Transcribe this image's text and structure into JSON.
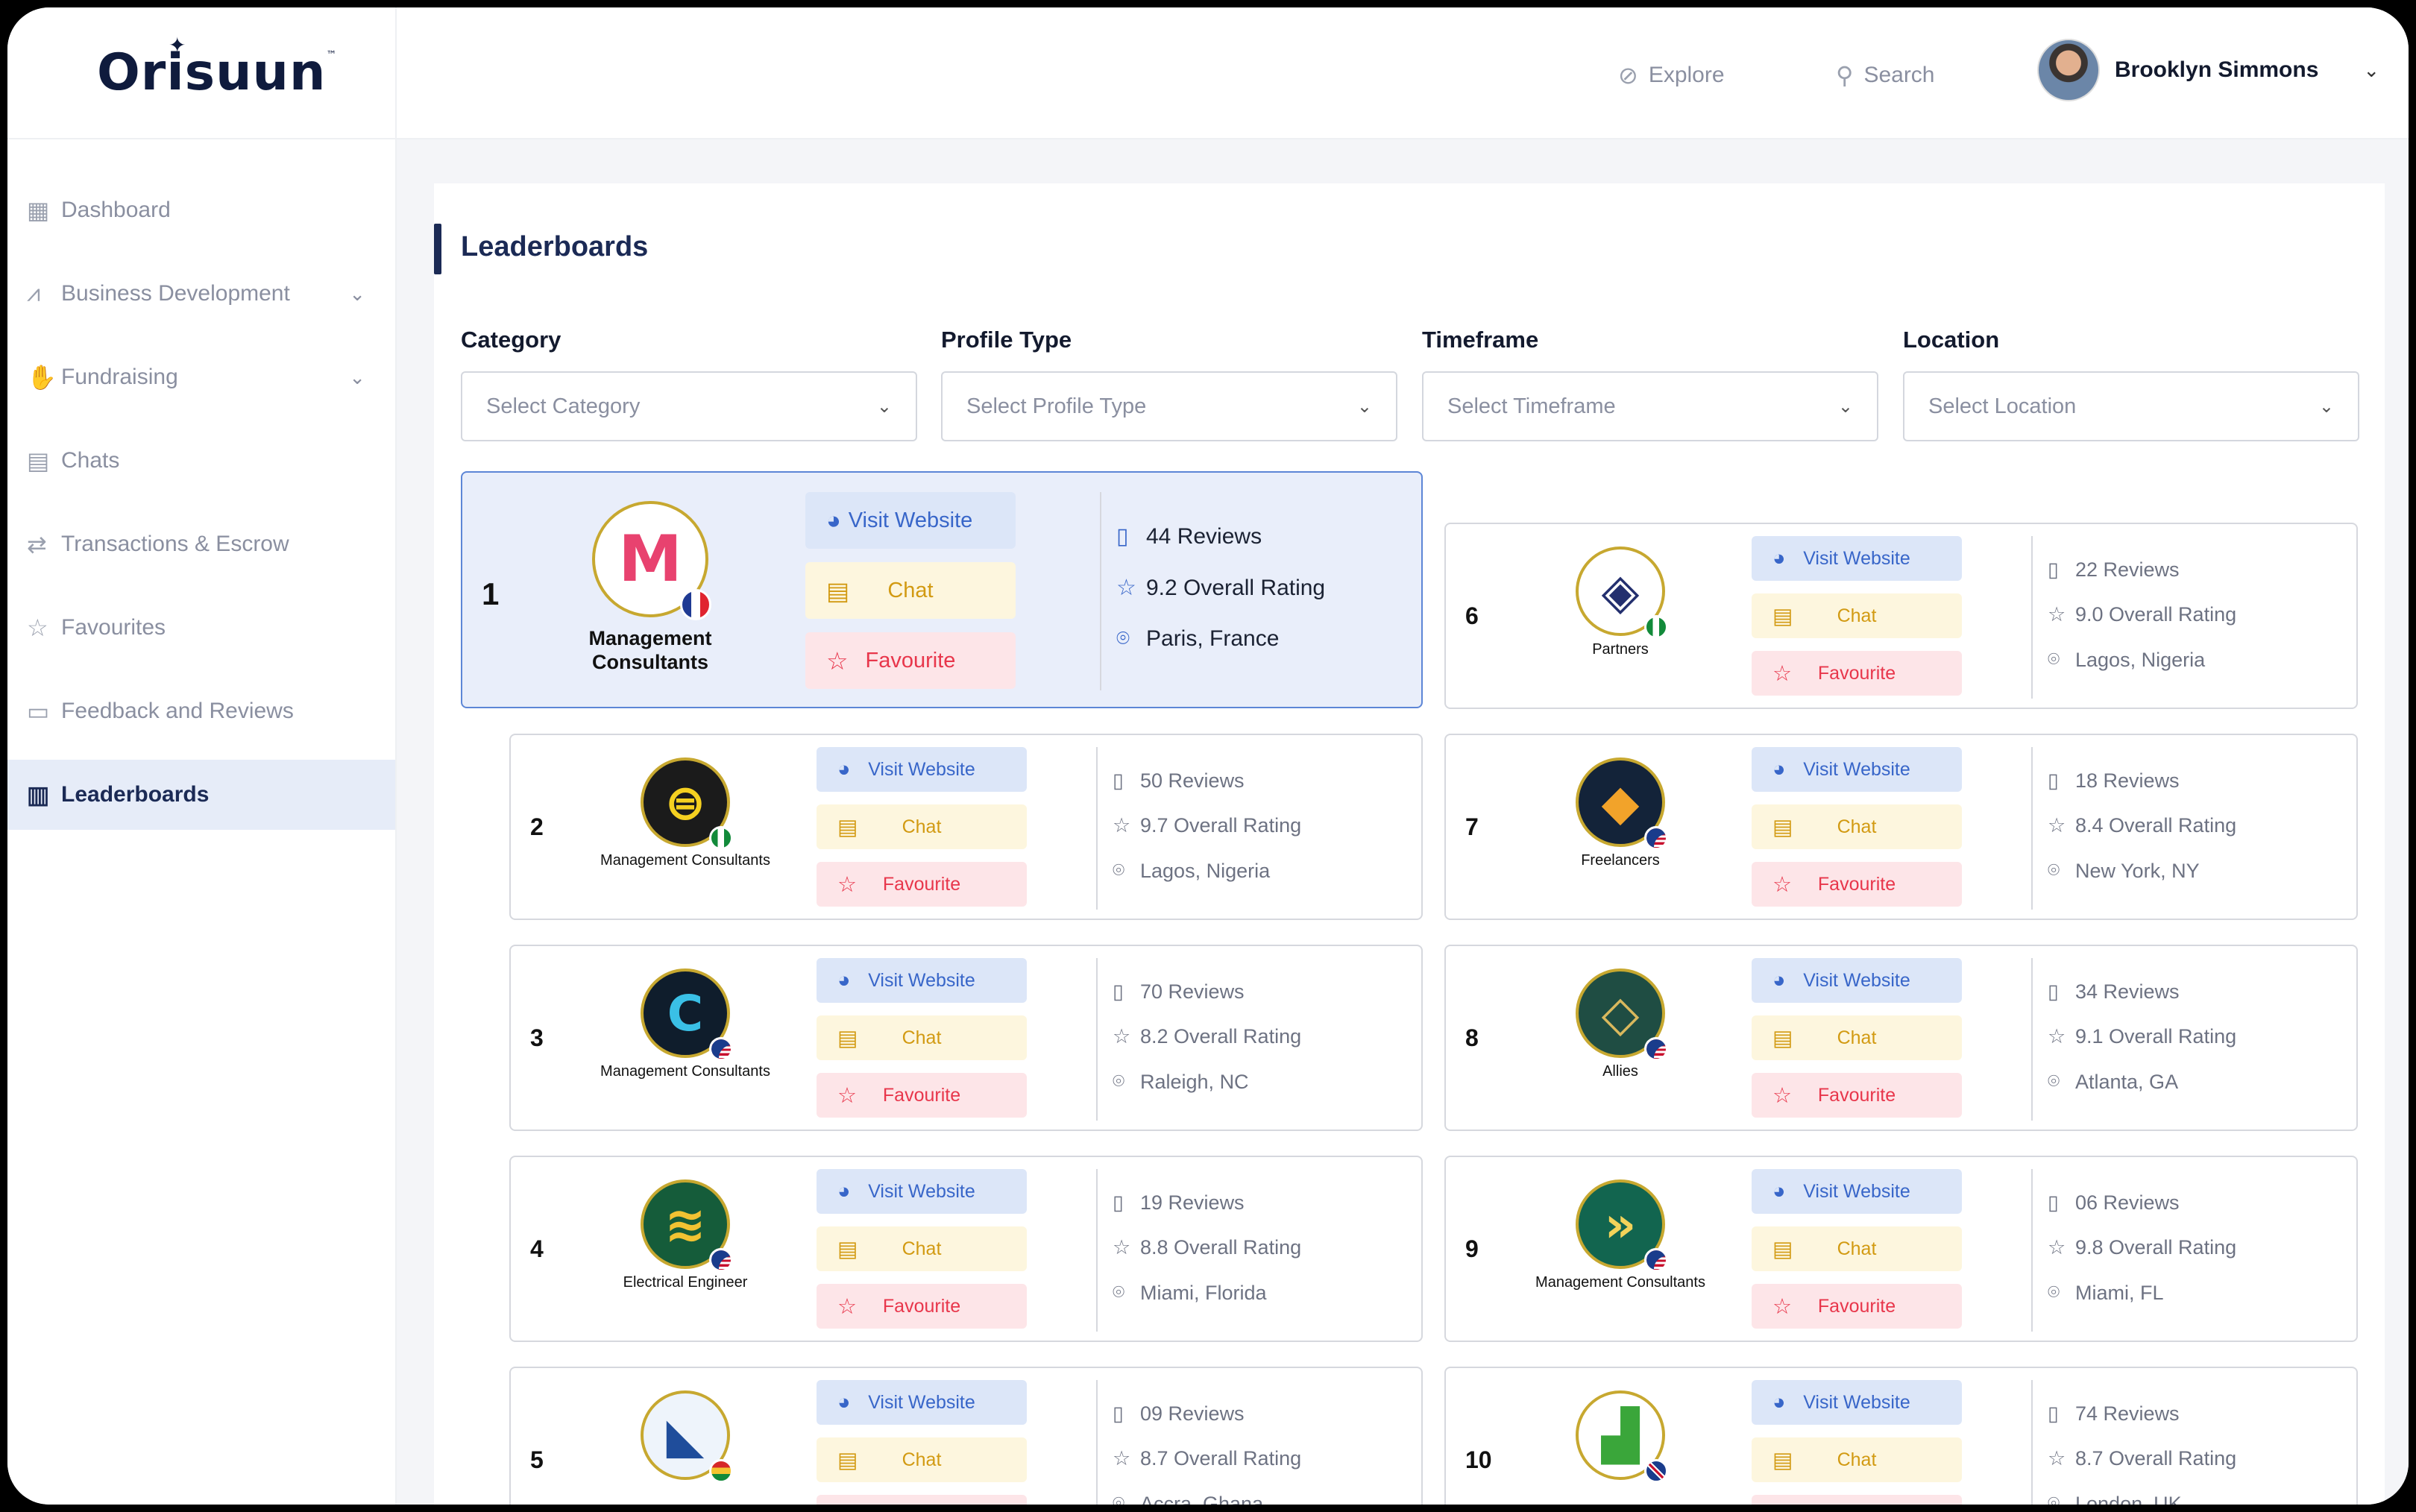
{
  "brand": {
    "name": "Orisuun",
    "tm": "™"
  },
  "sidebar": {
    "items": [
      {
        "label": "Dashboard",
        "icon": "grid-icon",
        "glyph": "▦",
        "chevron": false,
        "active": false
      },
      {
        "label": "Business Development",
        "icon": "chart-up-icon",
        "glyph": "⩘",
        "chevron": true,
        "active": false
      },
      {
        "label": "Fundraising",
        "icon": "handshake-icon",
        "glyph": "✋",
        "chevron": true,
        "active": false
      },
      {
        "label": "Chats",
        "icon": "message-icon",
        "glyph": "▤",
        "chevron": false,
        "active": false
      },
      {
        "label": "Transactions & Escrow",
        "icon": "transfer-icon",
        "glyph": "⇄",
        "chevron": false,
        "active": false
      },
      {
        "label": "Favourites",
        "icon": "star-icon",
        "glyph": "☆",
        "chevron": false,
        "active": false
      },
      {
        "label": "Feedback and Reviews",
        "icon": "feedback-icon",
        "glyph": "▭",
        "chevron": false,
        "active": false
      },
      {
        "label": "Leaderboards",
        "icon": "leaderboard-icon",
        "glyph": "▥",
        "chevron": false,
        "active": true
      }
    ]
  },
  "topbar": {
    "explore": "Explore",
    "search": "Search",
    "user_name": "Brooklyn Simmons"
  },
  "page": {
    "title": "Leaderboards"
  },
  "filters": [
    {
      "label": "Category",
      "placeholder": "Select Category"
    },
    {
      "label": "Profile Type",
      "placeholder": "Select Profile Type"
    },
    {
      "label": "Timeframe",
      "placeholder": "Select Timeframe"
    },
    {
      "label": "Location",
      "placeholder": "Select Location"
    }
  ],
  "actions": {
    "visit": "Visit Website",
    "chat": "Chat",
    "favourite": "Favourite"
  },
  "entries": [
    {
      "rank": "1",
      "type": "Management Consultants",
      "reviews": "44 Reviews",
      "rating": "9.2 Overall Rating",
      "location": "Paris, France",
      "logo_bg": "#ffffff",
      "logo_fg": "#e8426f",
      "logo_glyph": "M",
      "flag": "france"
    },
    {
      "rank": "2",
      "type": "Management Consultants",
      "reviews": "50 Reviews",
      "rating": "9.7 Overall Rating",
      "location": "Lagos, Nigeria",
      "logo_bg": "#1b1b1b",
      "logo_fg": "#f5d020",
      "logo_glyph": "⊜",
      "flag": "nigeria"
    },
    {
      "rank": "3",
      "type": "Management Consultants",
      "reviews": "70 Reviews",
      "rating": "8.2 Overall Rating",
      "location": "Raleigh, NC",
      "logo_bg": "#0f1d2c",
      "logo_fg": "#3ac0e6",
      "logo_glyph": "C",
      "flag": "usa"
    },
    {
      "rank": "4",
      "type": "Electrical Engineer",
      "reviews": "19 Reviews",
      "rating": "8.8 Overall Rating",
      "location": "Miami, Florida",
      "logo_bg": "#155c3a",
      "logo_fg": "#f2c232",
      "logo_glyph": "≋",
      "flag": "usa"
    },
    {
      "rank": "5",
      "type": "",
      "reviews": "09 Reviews",
      "rating": "8.7 Overall Rating",
      "location": "Accra, Ghana",
      "logo_bg": "#eef4fb",
      "logo_fg": "#1f4d9b",
      "logo_glyph": "◣",
      "flag": "ghana"
    },
    {
      "rank": "6",
      "type": "Partners",
      "reviews": "22 Reviews",
      "rating": "9.0 Overall Rating",
      "location": "Lagos, Nigeria",
      "logo_bg": "#ffffff",
      "logo_fg": "#232f6e",
      "logo_glyph": "◈",
      "flag": "nigeria"
    },
    {
      "rank": "7",
      "type": "Freelancers",
      "reviews": "18 Reviews",
      "rating": "8.4 Overall Rating",
      "location": "New York, NY",
      "logo_bg": "#132339",
      "logo_fg": "#f2a32a",
      "logo_glyph": "◆",
      "flag": "usa"
    },
    {
      "rank": "8",
      "type": "Allies",
      "reviews": "34 Reviews",
      "rating": "9.1 Overall Rating",
      "location": "Atlanta, GA",
      "logo_bg": "#1f4d43",
      "logo_fg": "#d9b85d",
      "logo_glyph": "◇",
      "flag": "usa"
    },
    {
      "rank": "9",
      "type": "Management Consultants",
      "reviews": "06 Reviews",
      "rating": "9.8 Overall Rating",
      "location": "Miami, FL",
      "logo_bg": "#12654f",
      "logo_fg": "#f3d35a",
      "logo_glyph": "»",
      "flag": "usa"
    },
    {
      "rank": "10",
      "type": "",
      "reviews": "74 Reviews",
      "rating": "8.7 Overall Rating",
      "location": "London, UK",
      "logo_bg": "#ffffff",
      "logo_fg": "#3aa63a",
      "logo_glyph": "▟",
      "flag": "uk"
    }
  ],
  "colors": {
    "accent": "#1b2a55",
    "highlight_bg": "#e9eefa",
    "highlight_border": "#5d86d6",
    "visit": "#3866c9",
    "chat": "#d29a12",
    "favourite": "#e8364b"
  }
}
